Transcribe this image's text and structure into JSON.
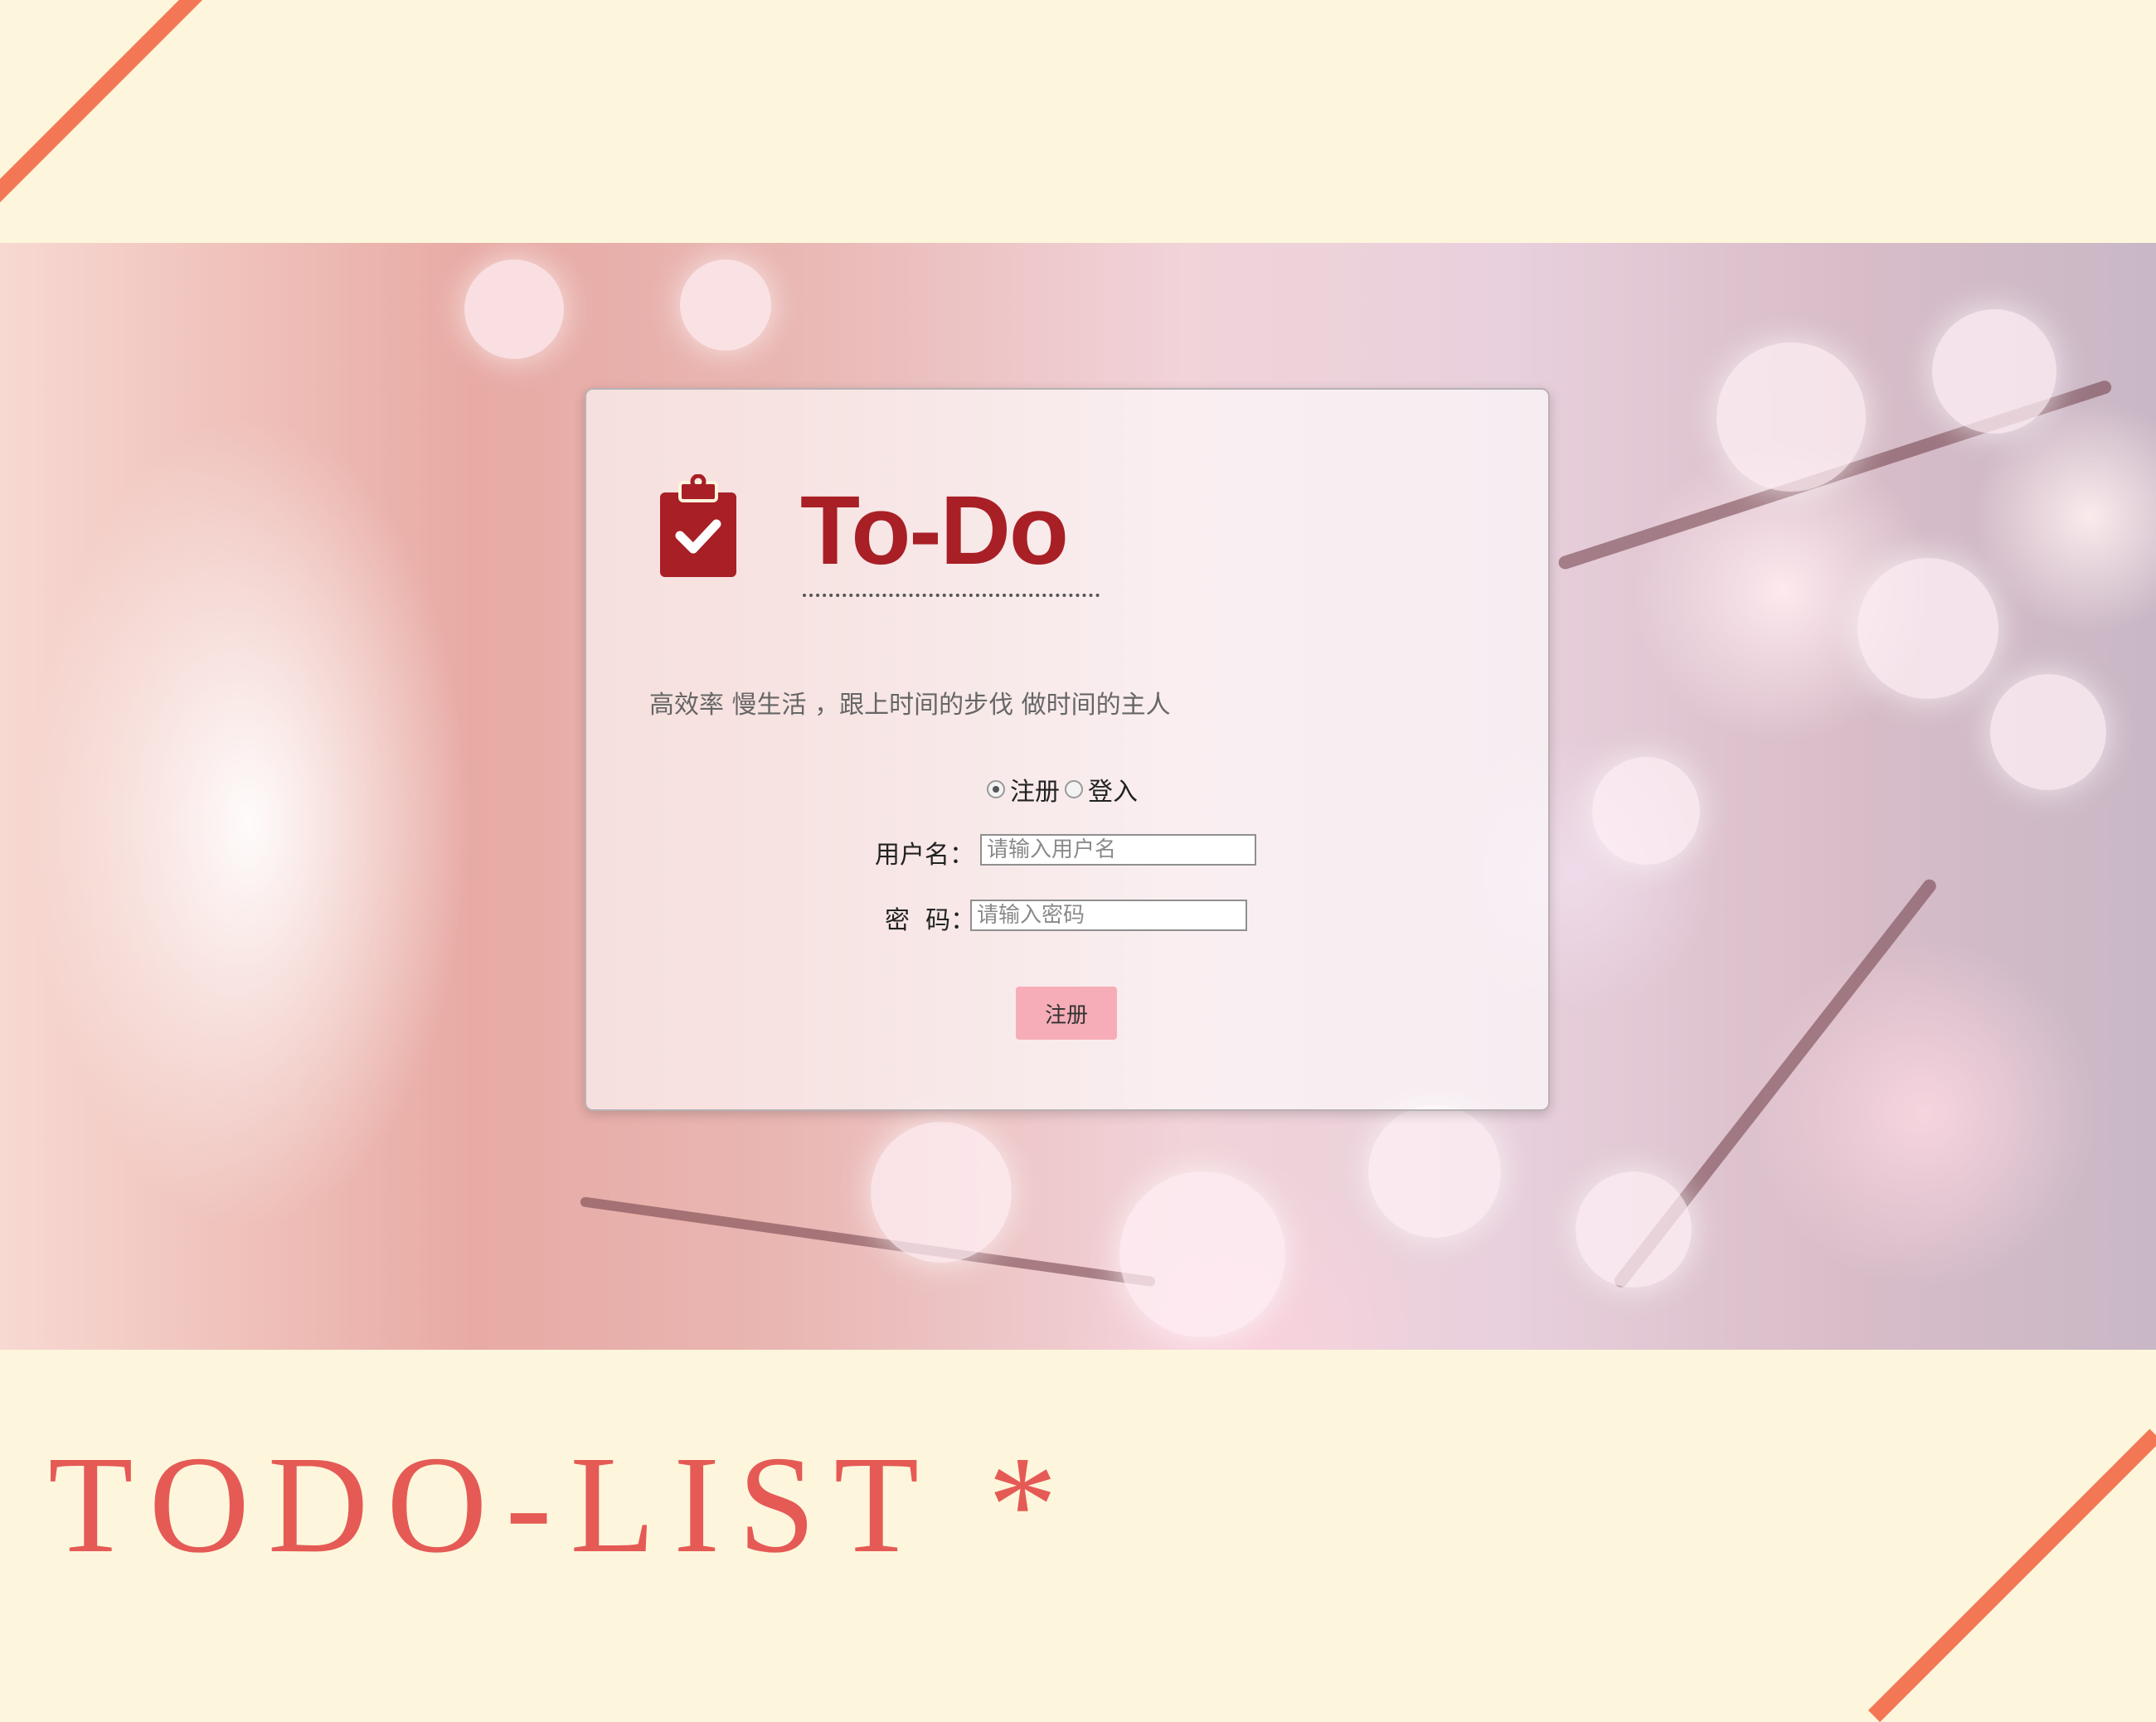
{
  "brand": {
    "title": "To-Do",
    "tagline": "高效率 慢生活 ，跟上时间的步伐 做时间的主人",
    "color": "#a81f26"
  },
  "form": {
    "mode_options": [
      {
        "label": "注册",
        "selected": true
      },
      {
        "label": "登入",
        "selected": false
      }
    ],
    "username": {
      "label": "用户名：",
      "placeholder": "请输入用户名",
      "value": ""
    },
    "password": {
      "label": "密  码：",
      "placeholder": "请输入密码",
      "value": ""
    },
    "submit_label": "注册",
    "button_color": "#f6adb8"
  },
  "footer": {
    "title": "TODO-LIST *",
    "color": "#e55a55"
  },
  "colors": {
    "background": "#fdf6dc",
    "accent_stripe": "#f47755"
  },
  "icons": {
    "logo": "clipboard-check-icon"
  }
}
